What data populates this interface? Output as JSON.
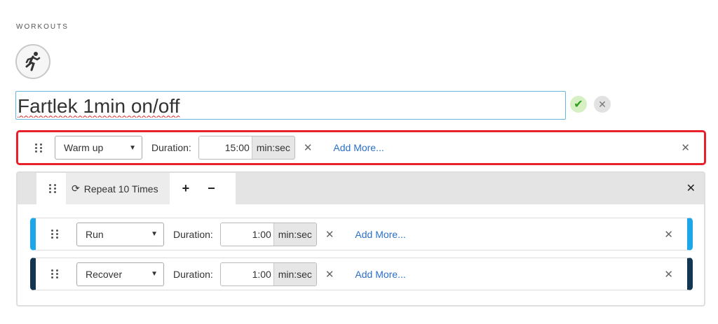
{
  "section": {
    "label": "WORKOUTS"
  },
  "sport": {
    "icon": "runner-icon"
  },
  "title": {
    "value": "Fartlek 1min on/off"
  },
  "actions": {
    "confirm_icon": "checkmark-icon",
    "cancel_icon": "close-icon"
  },
  "steps": [
    {
      "type": "Warm up",
      "duration_label": "Duration:",
      "duration": "15:00",
      "unit": "min:sec",
      "add_more": "Add More...",
      "color": "#e8202a"
    }
  ],
  "repeat": {
    "label": "Repeat 10 Times",
    "plus": "+",
    "minus": "−",
    "steps": [
      {
        "type": "Run",
        "duration_label": "Duration:",
        "duration": "1:00",
        "unit": "min:sec",
        "add_more": "Add More...",
        "color": "#1ea7e8"
      },
      {
        "type": "Recover",
        "duration_label": "Duration:",
        "duration": "1:00",
        "unit": "min:sec",
        "add_more": "Add More...",
        "color": "#123552"
      }
    ]
  },
  "glyphs": {
    "close": "✕",
    "dropdown_arrow": "▼",
    "check": "✔",
    "repeat_icon": "⟳"
  }
}
